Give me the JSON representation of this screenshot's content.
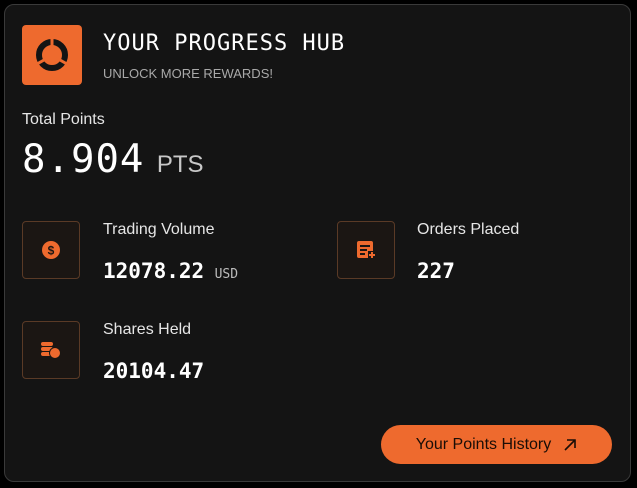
{
  "header": {
    "title": "YOUR PROGRESS HUB",
    "subtitle": "UNLOCK MORE REWARDS!",
    "logo_icon": "radar-ring-icon"
  },
  "total": {
    "label": "Total Points",
    "value": "8.904",
    "unit": "PTS"
  },
  "stats": {
    "trading_volume": {
      "label": "Trading Volume",
      "value": "12078.22",
      "unit": "USD",
      "icon": "dollar-coin-icon"
    },
    "orders_placed": {
      "label": "Orders Placed",
      "value": "227",
      "icon": "order-add-icon"
    },
    "shares_held": {
      "label": "Shares Held",
      "value": "20104.47",
      "icon": "coin-stack-icon"
    }
  },
  "history_button": {
    "label": "Your Points History",
    "icon": "arrow-up-right-icon"
  },
  "colors": {
    "accent": "#ee6a2e",
    "card_background": "#141414",
    "icon_tile_border": "#5a3a26"
  }
}
